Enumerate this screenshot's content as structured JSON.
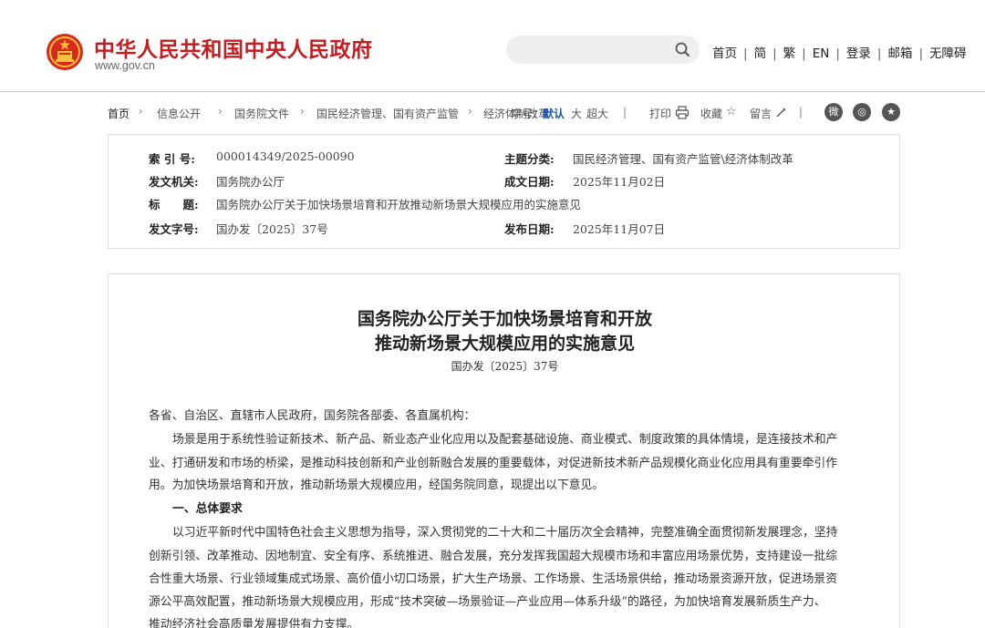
{
  "header": {
    "site_title": "中华人民共和国中央人民政府",
    "site_domain": "www.gov.cn",
    "search_placeholder": "",
    "nav": [
      "首页",
      "简",
      "繁",
      "EN",
      "登录",
      "邮箱",
      "无障碍"
    ],
    "brand_color": "#c51d20"
  },
  "breadcrumb": {
    "items": [
      "首页",
      "信息公开",
      "国务院文件",
      "国民经济管理、国有资产监管",
      "经济体制改革"
    ]
  },
  "toolbar": {
    "font_label": "字号：",
    "font_default": "默认",
    "font_large": "大",
    "font_xlarge": "超大",
    "print": "打印",
    "favorite": "收藏",
    "comment": "留言"
  },
  "meta": {
    "index_label": "索 引 号:",
    "index_value": "000014349/2025-00090",
    "topic_label": "主题分类:",
    "topic_value": "国民经济管理、国有资产监管\\经济体制改革",
    "issuer_label": "发文机关:",
    "issuer_value": "国务院办公厅",
    "written_label": "成文日期:",
    "written_value": "2025年11月02日",
    "title_label": "标　　题:",
    "title_value": "国务院办公厅关于加快场景培育和开放推动新场景大规模应用的实施意见",
    "docno_label": "发文字号:",
    "docno_value": "国办发〔2025〕37号",
    "published_label": "发布日期:",
    "published_value": "2025年11月07日"
  },
  "article": {
    "title_line1": "国务院办公厅关于加快场景培育和开放",
    "title_line2": "推动新场景大规模应用的实施意见",
    "doc_number": "国办发〔2025〕37号",
    "salutation": "各省、自治区、直辖市人民政府，国务院各部委、各直属机构：",
    "p1_l1": "场景是用于系统性验证新技术、新产品、新业态产业化应用以及配套基础设施、商业模式、制度政策的具体情境，是连接技术和产",
    "p1_l2": "业、打通研发和市场的桥梁，是推动科技创新和产业创新融合发展的重要载体，对促进新技术新产品规模化商业化应用具有重要牵引作",
    "p1_l3": "用。为加快场景培育和开放，推动新场景大规模应用，经国务院同意，现提出以下意见。",
    "section1": "一、总体要求",
    "p2_l1": "以习近平新时代中国特色社会主义思想为指导，深入贯彻党的二十大和二十届历次全会精神，完整准确全面贯彻新发展理念，坚持",
    "p2_l2": "创新引领、改革推动、因地制宜、安全有序、系统推进、融合发展，充分发挥我国超大规模市场和丰富应用场景优势，支持建设一批综",
    "p2_l3": "合性重大场景、行业领域集成式场景、高价值小切口场景，扩大生产场景、工作场景、生活场景供给，推动场景资源开放，促进场景资",
    "p2_l4": "源公平高效配置，推动新场景大规模应用，形成“技术突破—场景验证—产业应用—体系升级”的路径，为加快培育发展新质生产力、",
    "p2_l5": "推动经济社会高质量发展提供有力支撑。"
  }
}
